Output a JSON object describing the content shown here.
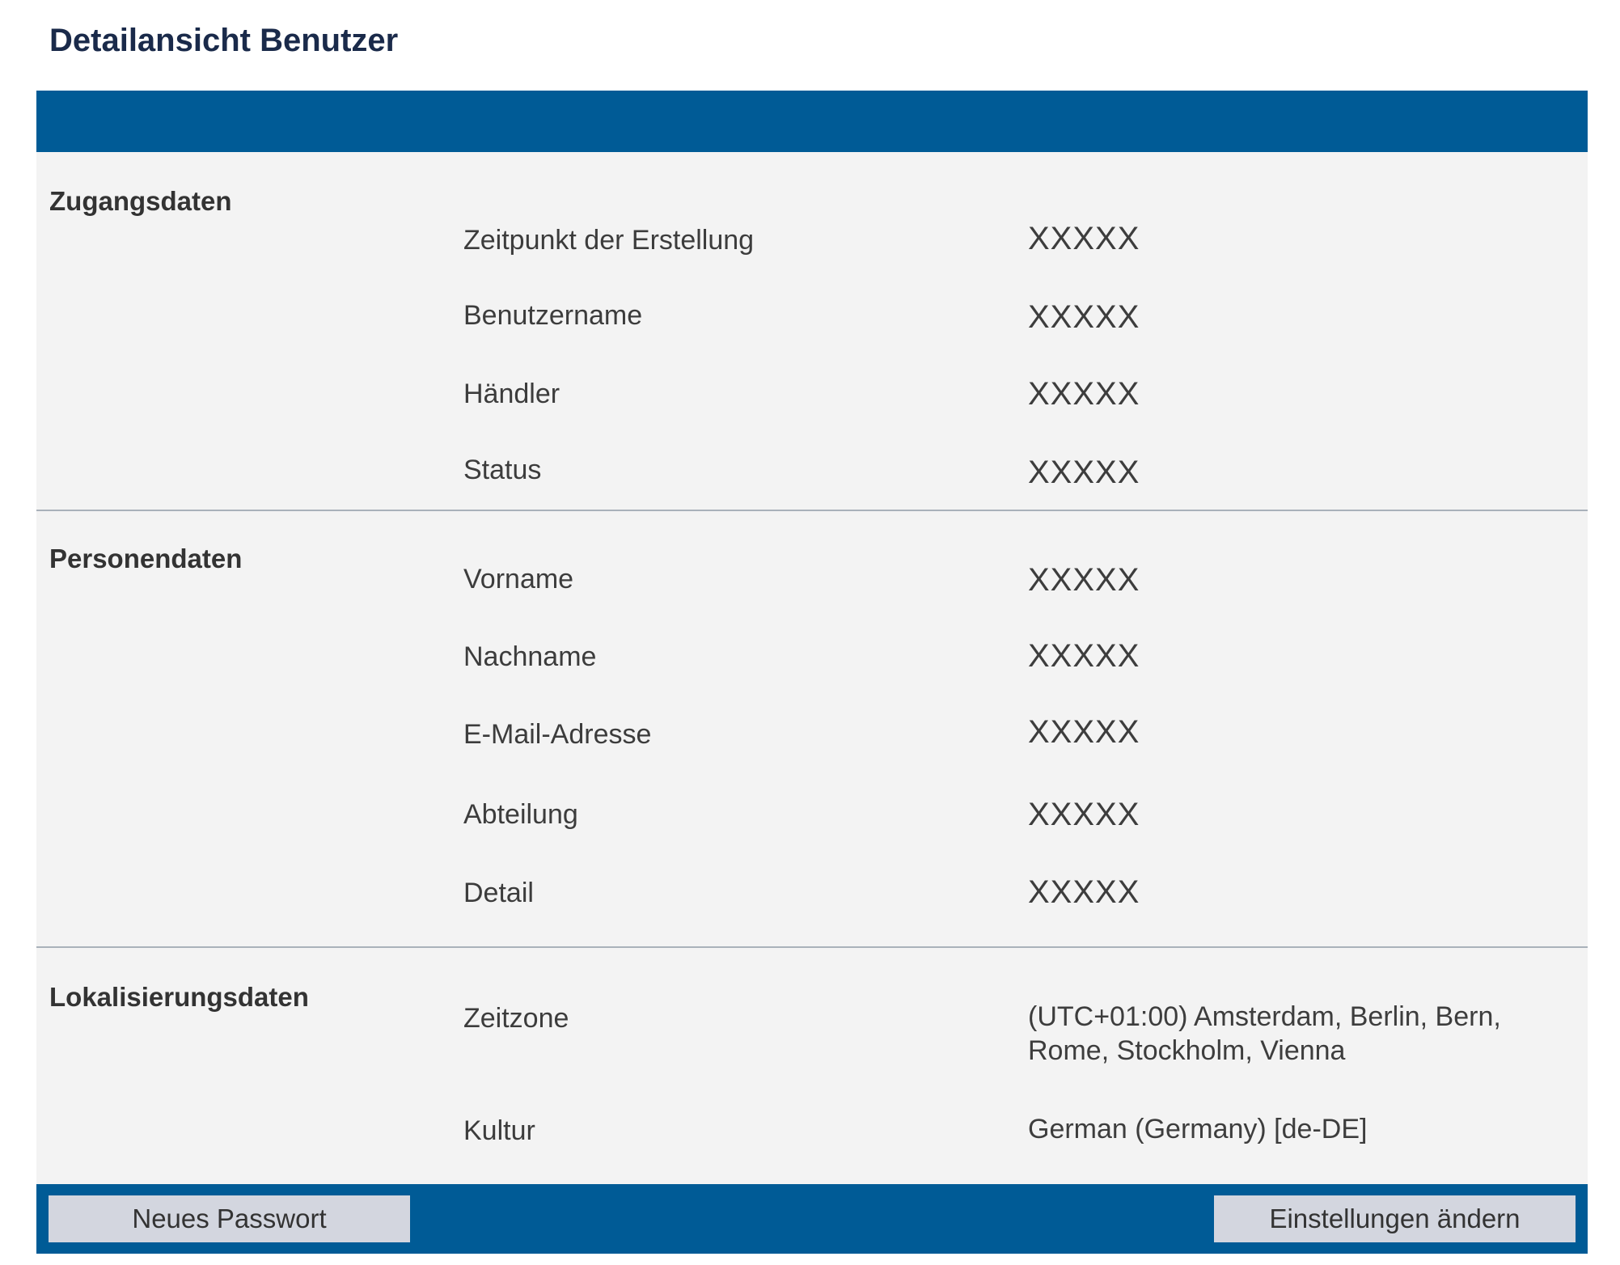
{
  "page": {
    "title": "Detailansicht Benutzer"
  },
  "sections": {
    "access": {
      "title": "Zugangsdaten",
      "fields": [
        {
          "label": "Zeitpunkt der Erstellung",
          "value": "XXXXX"
        },
        {
          "label": "Benutzername",
          "value": "XXXXX"
        },
        {
          "label": "Händler",
          "value": "XXXXX"
        },
        {
          "label": "Status",
          "value": "XXXXX"
        }
      ]
    },
    "person": {
      "title": "Personendaten",
      "fields": [
        {
          "label": "Vorname",
          "value": "XXXXX"
        },
        {
          "label": "Nachname",
          "value": "XXXXX"
        },
        {
          "label": "E-Mail-Adresse",
          "value": "XXXXX"
        },
        {
          "label": "Abteilung",
          "value": "XXXXX"
        },
        {
          "label": "Detail",
          "value": "XXXXX"
        }
      ]
    },
    "localization": {
      "title": "Lokalisierungsdaten",
      "fields": [
        {
          "label": "Zeitzone",
          "value": "(UTC+01:00) Amsterdam, Berlin, Bern, Rome, Stockholm, Vienna"
        },
        {
          "label": "Kultur",
          "value": "German (Germany) [de-DE]"
        }
      ]
    }
  },
  "footer": {
    "new_password_label": "Neues Passwort",
    "change_settings_label": "Einstellungen ändern"
  },
  "colors": {
    "header_blue": "#005b96",
    "panel_background": "#f3f3f3",
    "button_background": "#d3d6df"
  }
}
